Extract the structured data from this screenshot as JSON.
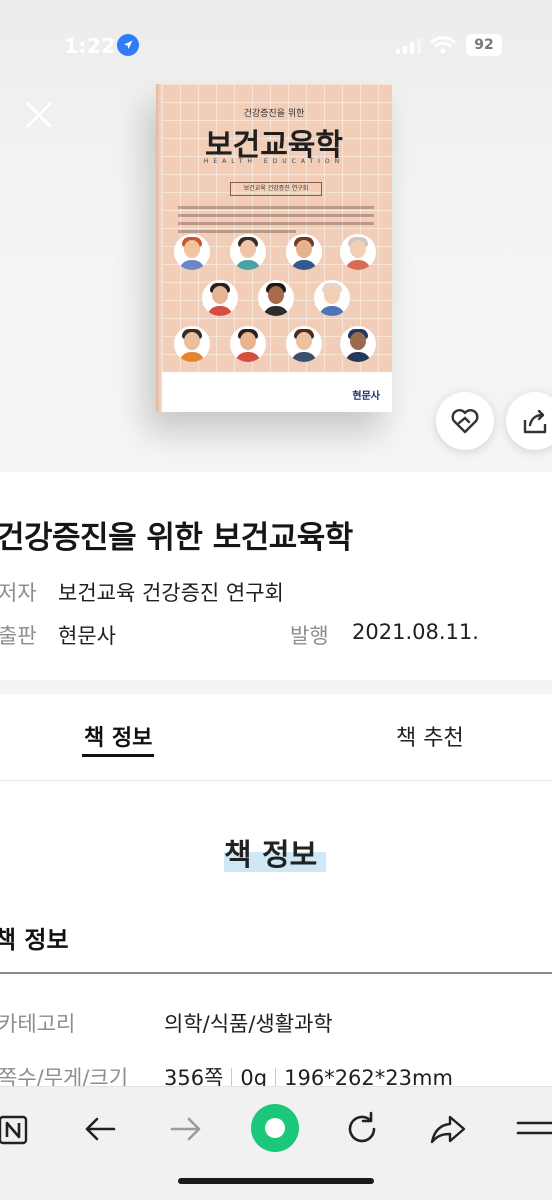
{
  "status_bar": {
    "time": "1:22",
    "battery": "92"
  },
  "cover": {
    "kicker": "건강증진을 위한",
    "title": "보건교육학",
    "english": "HEALTH EDUCATION",
    "tag": "보건교육 건강증진 연구회",
    "publisher": "현문사"
  },
  "book": {
    "title": "건강증진을 위한 보건교육학",
    "author_label": "저자",
    "author": "보건교육 건강증진 연구회",
    "publisher_label": "출판",
    "publisher": "현문사",
    "published_label": "발행",
    "published": "2021.08.11."
  },
  "tabs": [
    {
      "label": "책 정보"
    },
    {
      "label": "책 추천"
    }
  ],
  "section": {
    "heading": "책 정보",
    "subheading": "책 정보",
    "rows": [
      {
        "label": "카테고리",
        "value": "의학/식품/생활과학"
      },
      {
        "label": "쪽수/무게/크기",
        "pages": "356쪽",
        "weight": "0g",
        "size": "196*262*23mm"
      }
    ]
  },
  "colors": {
    "accent": "#1bc77a",
    "highlight": "#cfe8f7",
    "cover": "#f2cdb7"
  }
}
